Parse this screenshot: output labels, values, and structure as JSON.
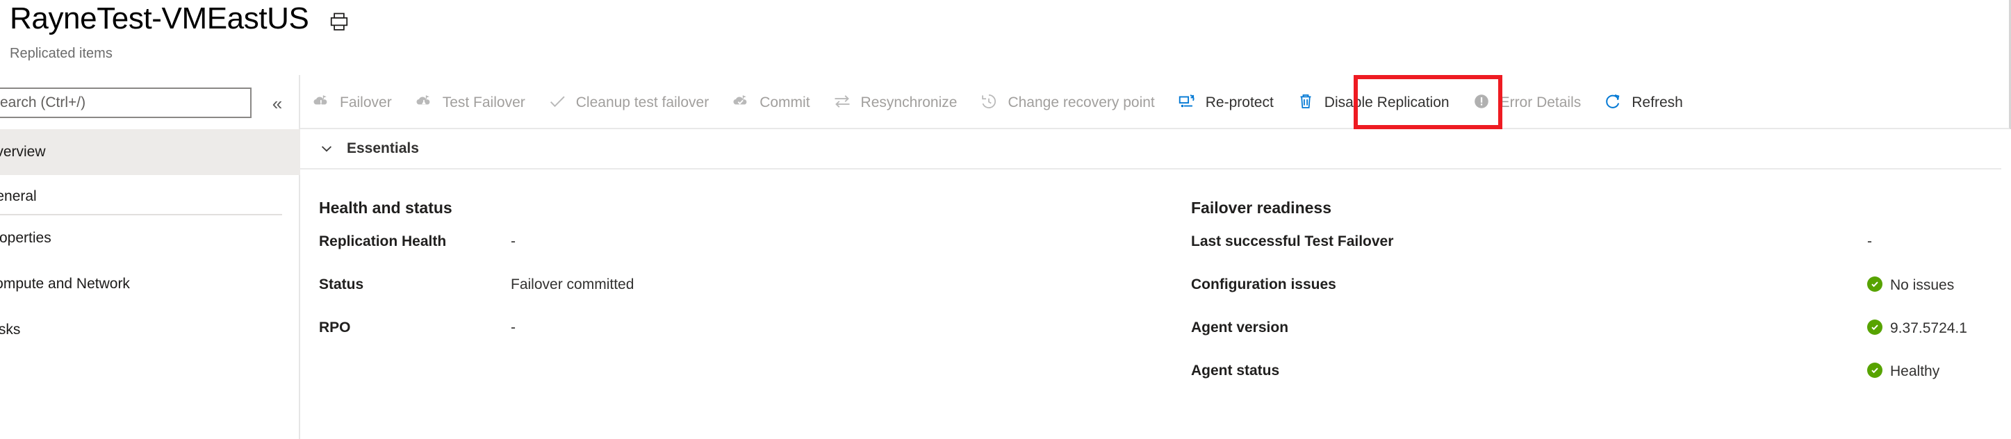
{
  "header": {
    "title": "RayneTest-VMEastUS",
    "subtitle": "Replicated items",
    "print_icon": "print-icon"
  },
  "leftnav": {
    "search": {
      "placeholder": "Search (Ctrl+/)",
      "value": ""
    },
    "collapse_label": "«",
    "items": [
      {
        "label": "Overview",
        "type": "item",
        "selected": true
      },
      {
        "label": "General",
        "type": "section",
        "selected": false
      },
      {
        "label": "Properties",
        "type": "item",
        "selected": false
      },
      {
        "label": "Compute and Network",
        "type": "item",
        "selected": false
      },
      {
        "label": "Disks",
        "type": "item",
        "selected": false
      }
    ]
  },
  "commandbar": {
    "items": [
      {
        "label": "Failover",
        "icon": "failover-icon",
        "enabled": false
      },
      {
        "label": "Test Failover",
        "icon": "test-failover-icon",
        "enabled": false
      },
      {
        "label": "Cleanup test failover",
        "icon": "checkmark-icon",
        "enabled": false
      },
      {
        "label": "Commit",
        "icon": "commit-icon",
        "enabled": false
      },
      {
        "label": "Resynchronize",
        "icon": "resynchronize-icon",
        "enabled": false
      },
      {
        "label": "Change recovery point",
        "icon": "clock-history-icon",
        "enabled": false
      },
      {
        "label": "Re-protect",
        "icon": "re-protect-icon",
        "enabled": true
      },
      {
        "label": "Disable Replication",
        "icon": "trash-icon",
        "enabled": true
      },
      {
        "label": "Error Details",
        "icon": "error-circle-icon",
        "enabled": false
      },
      {
        "label": "Refresh",
        "icon": "refresh-icon",
        "enabled": true
      }
    ],
    "highlight": {
      "target_label": "Re-protect",
      "color": "#ee1b22"
    }
  },
  "essentials": {
    "title": "Essentials",
    "expanded": true,
    "chevron_icon": "chevron-down-icon",
    "columns": [
      {
        "heading": "Health and status",
        "rows": [
          {
            "key": "Replication Health",
            "value": "-",
            "status": "none"
          },
          {
            "key": "Status",
            "value": "Failover committed",
            "status": "none"
          },
          {
            "key": "RPO",
            "value": "-",
            "status": "none"
          }
        ]
      },
      {
        "heading": "Failover readiness",
        "rows": [
          {
            "key": "Last successful Test Failover",
            "value": "-",
            "status": "none"
          },
          {
            "key": "Configuration issues",
            "value": "No issues",
            "status": "ok"
          },
          {
            "key": "Agent version",
            "value": "9.37.5724.1",
            "status": "ok"
          },
          {
            "key": "Agent status",
            "value": "Healthy",
            "status": "ok"
          }
        ]
      }
    ]
  },
  "colors": {
    "highlight_red": "#ee1b22",
    "status_green": "#57a300",
    "accent_blue": "#0078d4",
    "disabled_gray": "#a19f9d"
  }
}
